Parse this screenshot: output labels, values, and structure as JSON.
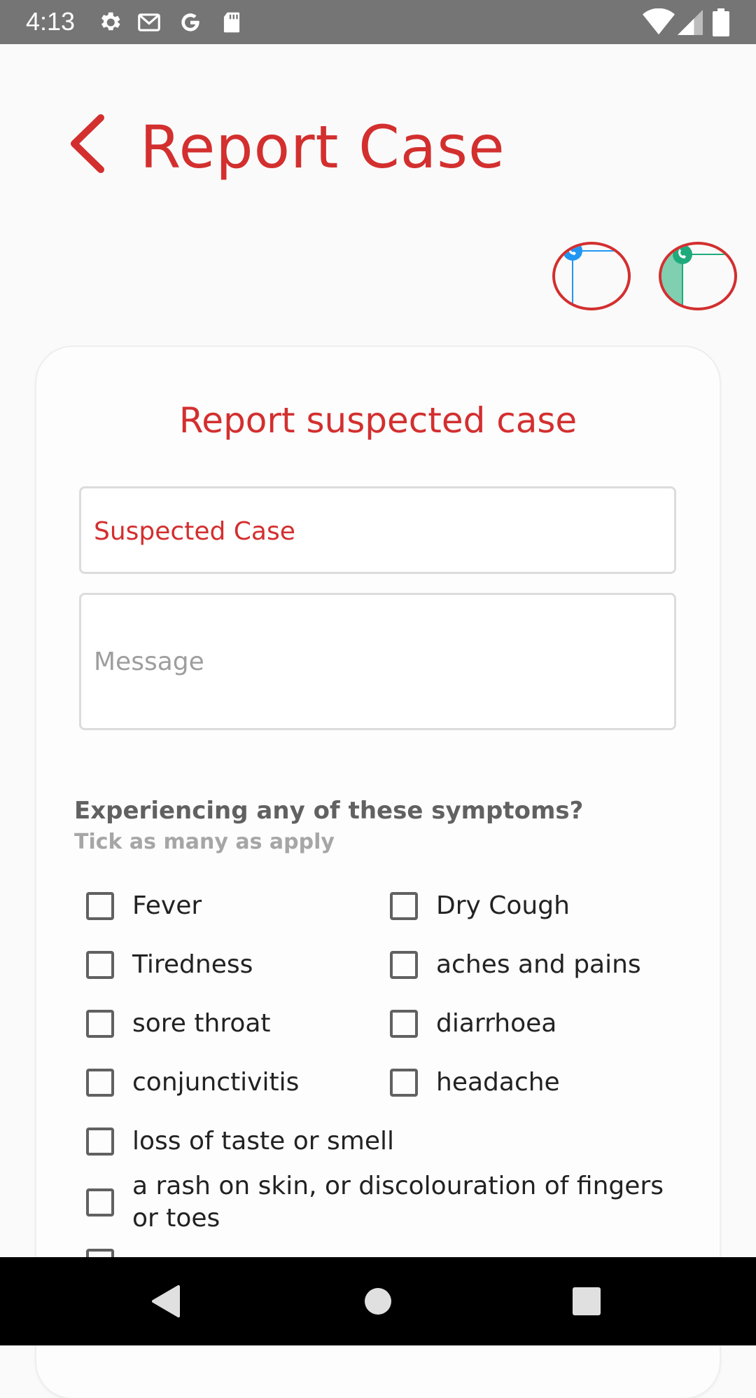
{
  "status_bar": {
    "time": "4:13",
    "icons": [
      "settings-icon",
      "gmail-icon",
      "google-icon",
      "sd-card-icon"
    ],
    "right_icons": [
      "wifi-icon",
      "signal-icon",
      "battery-icon"
    ]
  },
  "header": {
    "title": "Report Case",
    "back_icon": "chevron-left-icon"
  },
  "contact_buttons": {
    "call_icon": "phone-call-icon",
    "whatsapp_icon": "whatsapp-icon"
  },
  "form": {
    "title": "Report suspected case",
    "suspected_case_value": "Suspected Case",
    "message_placeholder": "Message",
    "symptoms_heading": "Experiencing any of these symptoms?",
    "symptoms_subheading": "Tick as many as apply",
    "symptoms": [
      {
        "label": "Fever",
        "checked": false
      },
      {
        "label": "Dry Cough",
        "checked": false
      },
      {
        "label": "Tiredness",
        "checked": false
      },
      {
        "label": "aches and pains",
        "checked": false
      },
      {
        "label": "sore throat",
        "checked": false
      },
      {
        "label": "diarrhoea",
        "checked": false
      },
      {
        "label": "conjunctivitis",
        "checked": false
      },
      {
        "label": "headache",
        "checked": false
      },
      {
        "label": "loss of taste or smell",
        "checked": false
      },
      {
        "label": "a rash on skin, or discolouration of fingers or toes",
        "checked": false
      }
    ]
  },
  "colors": {
    "accent": "#d32f2f",
    "status_bar": "#757575",
    "nav_bar": "#000000",
    "call_blue": "#2196f3",
    "whatsapp_green": "#1faa7c"
  },
  "nav_bar": {
    "icons": [
      "back-triangle-icon",
      "home-circle-icon",
      "recents-square-icon"
    ]
  }
}
